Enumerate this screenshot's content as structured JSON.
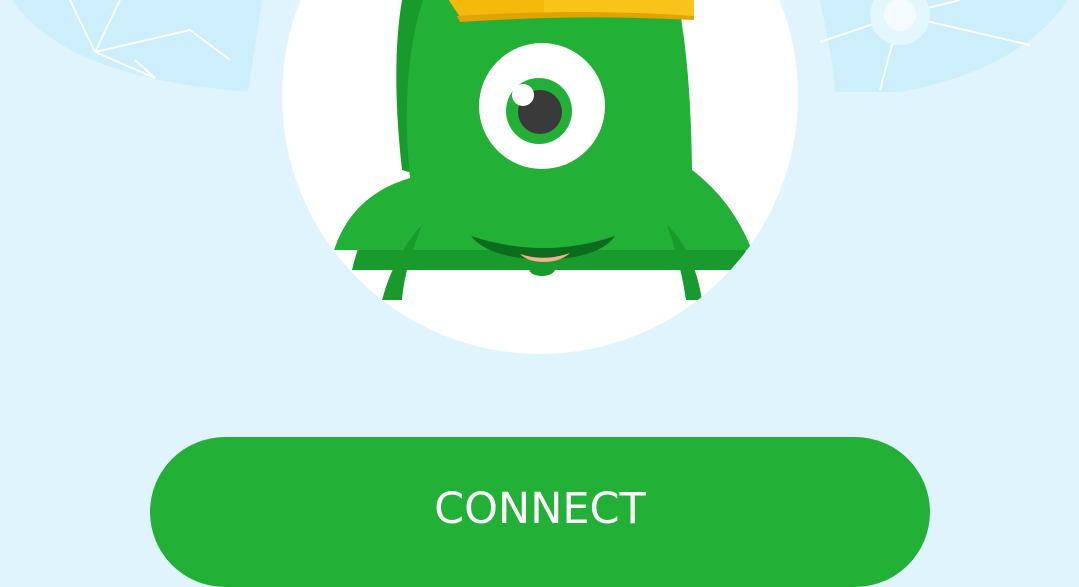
{
  "icons": {
    "background": "world-map-network-icon",
    "mascot": "green-one-eyed-monster-icon"
  },
  "connect": {
    "label": "CONNECT"
  },
  "colors": {
    "background": "#dff4fd",
    "button": "#22b037",
    "button_text": "#ffffff",
    "mascot_body": "#22b037",
    "mascot_shadow": "#189a2c",
    "crown": "#f5b80c"
  }
}
